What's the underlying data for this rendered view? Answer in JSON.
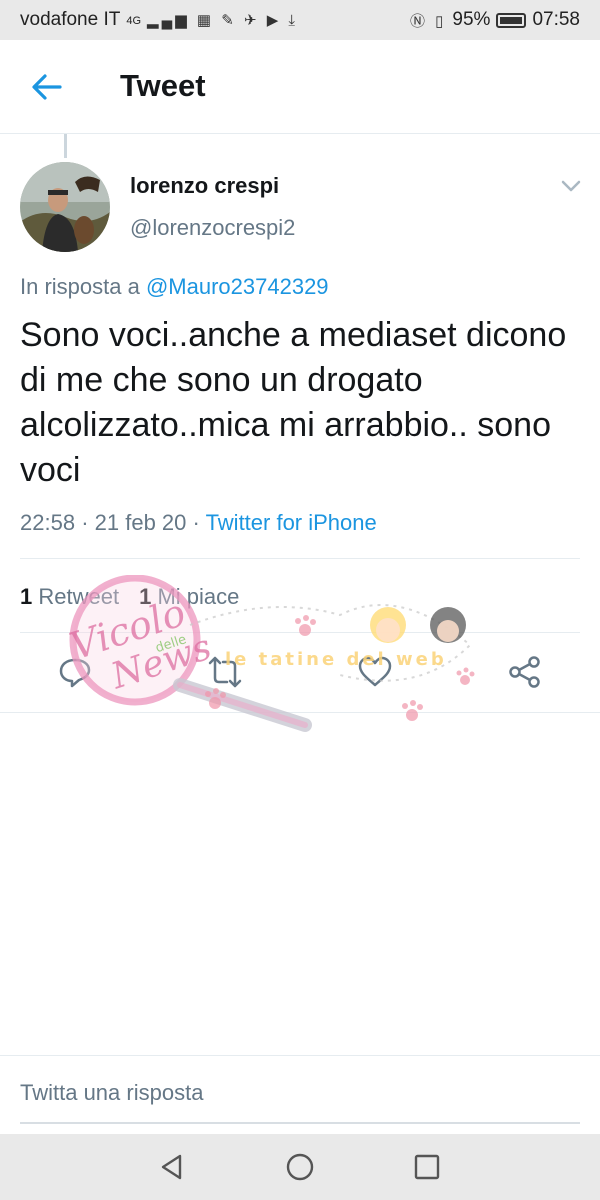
{
  "status_bar": {
    "carrier": "vodafone IT",
    "network": "4G",
    "battery_percent": "95%",
    "time": "07:58"
  },
  "header": {
    "title": "Tweet",
    "back_icon": "arrow-left-icon"
  },
  "tweet": {
    "display_name": "lorenzo crespi",
    "handle": "@lorenzocrespi2",
    "reply_prefix": "In risposta a",
    "reply_mention": "@Mauro23742329",
    "text": "Sono voci..anche a mediaset dicono di me che sono un drogato alcolizzato..mica mi arrabbio.. sono voci",
    "time": "22:58",
    "separator": "·",
    "date": "21 feb 20",
    "source": "Twitter for iPhone",
    "retweets_count": "1",
    "retweets_label": "Retweet",
    "likes_count": "1",
    "likes_label": "Mi piace"
  },
  "actions": [
    "reply-icon",
    "retweet-icon",
    "like-icon",
    "share-icon"
  ],
  "watermark": {
    "brand_name": "Vicolo delle News",
    "tagline": "le tatine del web"
  },
  "reply_bar": {
    "placeholder": "Twitta una risposta"
  },
  "colors": {
    "accent": "#1b95e0",
    "text": "#14171a",
    "secondary": "#657786",
    "divider": "#e6ecf0"
  }
}
